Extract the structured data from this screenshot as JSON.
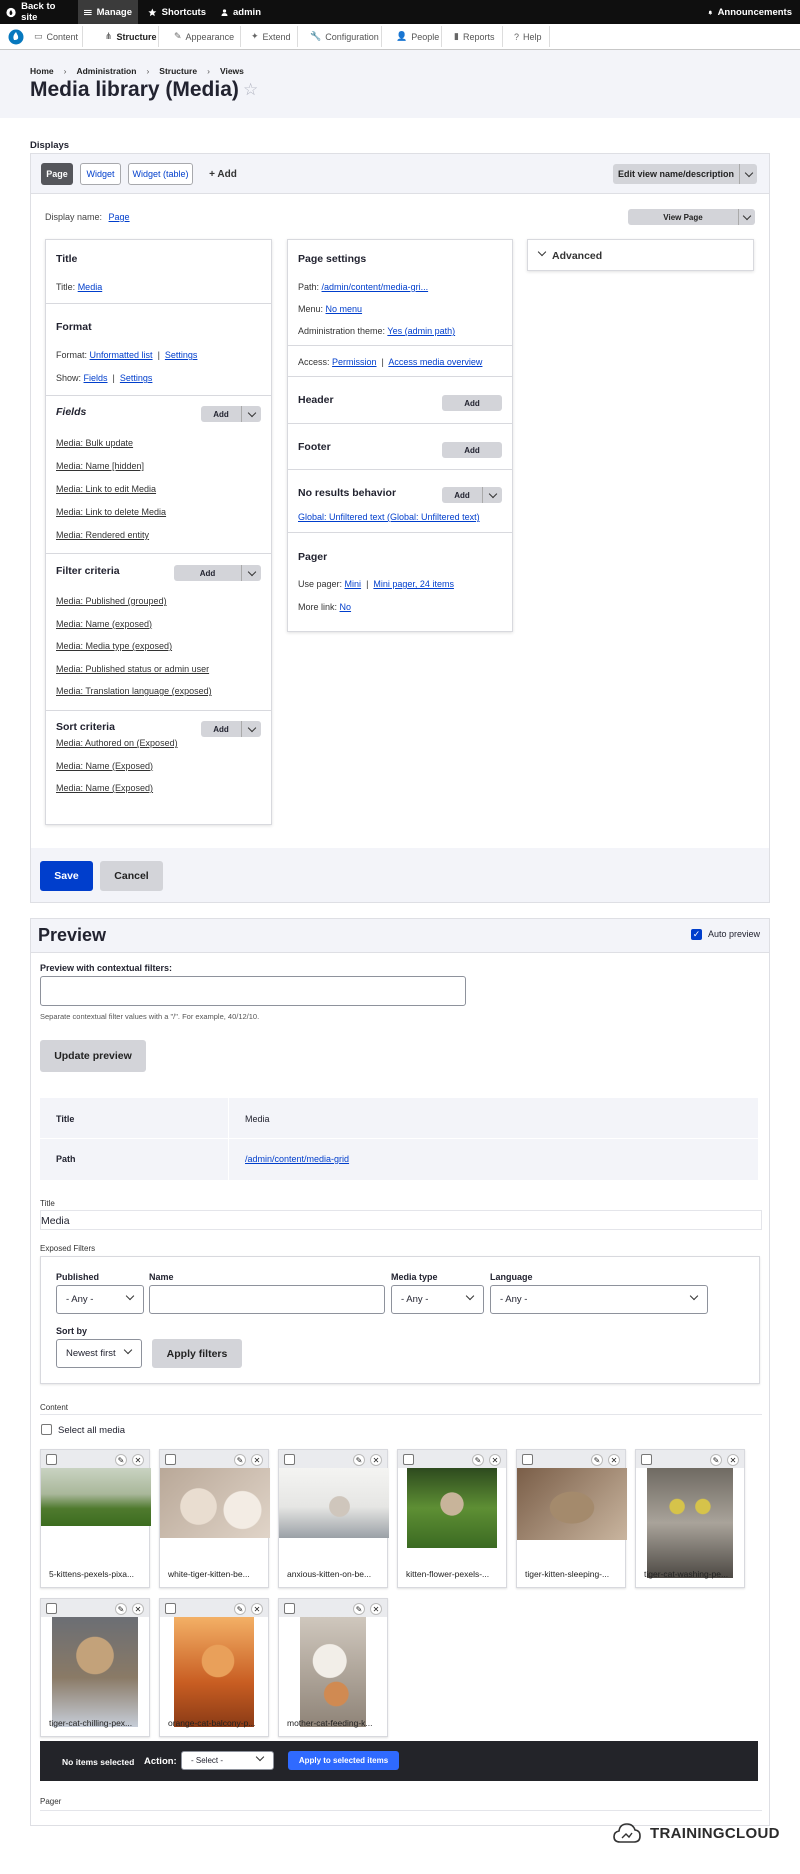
{
  "toolbar": {
    "back": "Back to site",
    "manage": "Manage",
    "shortcuts": "Shortcuts",
    "user": "admin",
    "announcements": "Announcements"
  },
  "tray": [
    "Content",
    "Structure",
    "Appearance",
    "Extend",
    "Configuration",
    "People",
    "Reports",
    "Help"
  ],
  "breadcrumb": [
    "Home",
    "Administration",
    "Structure",
    "Views"
  ],
  "page_title": "Media library (Media)",
  "displays": {
    "heading": "Displays",
    "tabs": [
      "Page",
      "Widget",
      "Widget (table)"
    ],
    "add": "+ Add",
    "edit_view": "Edit view name/description",
    "display_name_label": "Display name:",
    "display_name_value": "Page",
    "view_page": "View Page"
  },
  "col1": {
    "title_h": "Title",
    "title_label": "Title:",
    "title_value": "Media",
    "format_h": "Format",
    "format_label": "Format:",
    "format_value": "Unformatted list",
    "format_settings": "Settings",
    "show_label": "Show:",
    "show_value": "Fields",
    "show_settings": "Settings",
    "fields_h": "Fields",
    "fields": [
      "Media: Bulk update",
      "Media: Name [hidden]",
      "Media: Link to edit Media",
      "Media: Link to delete Media",
      "Media: Rendered entity"
    ],
    "filter_h": "Filter criteria",
    "filters": [
      "Media: Published (grouped)",
      "Media: Name (exposed)",
      "Media: Media type (exposed)",
      "Media: Published status or admin user",
      "Media: Translation language (exposed)"
    ],
    "sort_h": "Sort criteria",
    "sorts": [
      "Media: Authored on (Exposed)",
      "Media: Name (Exposed)",
      "Media: Name (Exposed)"
    ],
    "add": "Add"
  },
  "col2": {
    "page_settings_h": "Page settings",
    "path_label": "Path:",
    "path_value": "/admin/content/media-gri...",
    "menu_label": "Menu:",
    "menu_value": "No menu",
    "admin_theme_label": "Administration theme:",
    "admin_theme_value": "Yes (admin path)",
    "access_label": "Access:",
    "access_value": "Permission",
    "access_value2": "Access media overview",
    "header_h": "Header",
    "footer_h": "Footer",
    "no_results_h": "No results behavior",
    "no_results_value": "Global: Unfiltered text (Global: Unfiltered text)",
    "pager_h": "Pager",
    "use_pager_label": "Use pager:",
    "use_pager_value": "Mini",
    "use_pager_value2": "Mini pager, 24 items",
    "more_link_label": "More link:",
    "more_link_value": "No",
    "add": "Add"
  },
  "col3": {
    "advanced": "Advanced"
  },
  "actions": {
    "save": "Save",
    "cancel": "Cancel"
  },
  "preview": {
    "heading": "Preview",
    "auto_preview": "Auto preview",
    "contextual_label": "Preview with contextual filters:",
    "contextual_value": "",
    "contextual_help": "Separate contextual filter values with a \"/\". For example, 40/12/10.",
    "update": "Update preview",
    "info": [
      {
        "label": "Title",
        "value": "Media"
      },
      {
        "label": "Path",
        "value": "/admin/content/media-grid"
      }
    ],
    "title_label": "Title",
    "title_value": "Media",
    "exposed_label": "Exposed Filters",
    "filters": {
      "published_label": "Published",
      "published_value": "- Any -",
      "name_label": "Name",
      "name_value": "",
      "media_type_label": "Media type",
      "media_type_value": "- Any -",
      "language_label": "Language",
      "language_value": "- Any -",
      "sort_label": "Sort by",
      "sort_value": "Newest first",
      "apply": "Apply filters"
    },
    "content_label": "Content",
    "select_all": "Select all media",
    "media": [
      "5-kittens-pexels-pixa...",
      "white-tiger-kitten-be...",
      "anxious-kitten-on-be...",
      "kitten-flower-pexels-...",
      "tiger-kitten-sleeping-...",
      "tiger-cat-washing-pe...",
      "tiger-cat-chilling-pex...",
      "orange-cat-balcony-p...",
      "mother-cat-feeding-k..."
    ],
    "bulk": {
      "none_selected": "No items selected",
      "action_label": "Action:",
      "action_value": "- Select -",
      "apply": "Apply to selected items"
    },
    "pager_label": "Pager"
  },
  "brand": "TRAININGCLOUD",
  "colors": {
    "primary": "#003ecc",
    "bulk_bg": "#232429",
    "apply_bulk": "#2f6aff",
    "header_bg": "#f3f4f9"
  }
}
